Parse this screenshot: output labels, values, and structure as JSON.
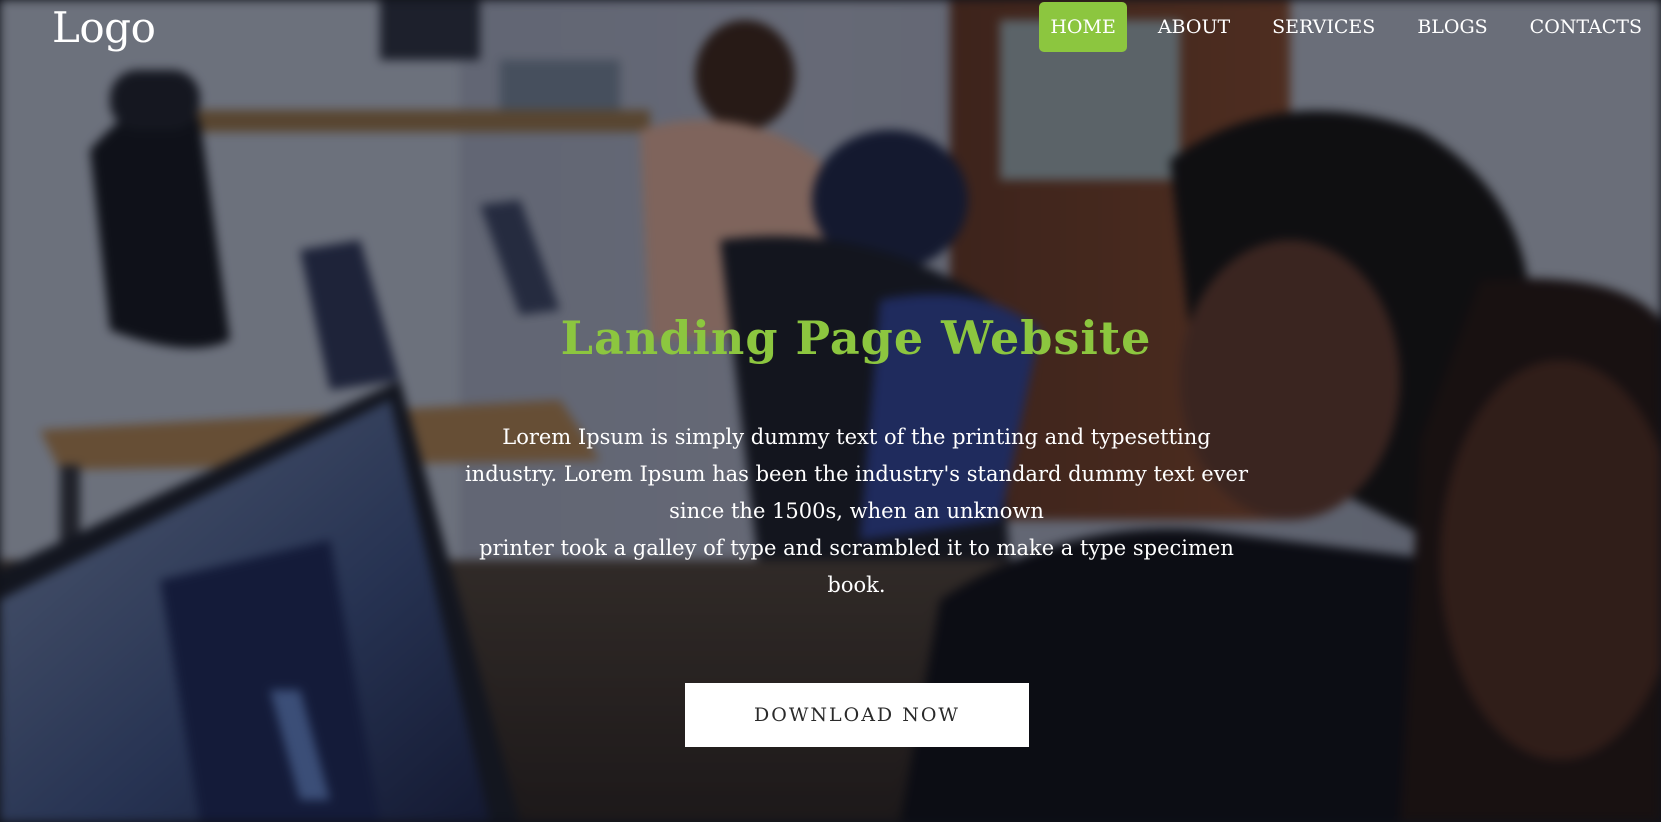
{
  "logo": {
    "text": "Logo"
  },
  "nav": {
    "items": [
      {
        "label": "HOME",
        "active": true
      },
      {
        "label": "ABOUT",
        "active": false
      },
      {
        "label": "SERVICES",
        "active": false
      },
      {
        "label": "BLOGS",
        "active": false
      },
      {
        "label": "CONTACTS",
        "active": false
      }
    ]
  },
  "hero": {
    "title": "Landing Page Website",
    "description_lines": [
      "Lorem Ipsum is simply dummy text of the printing and typesetting industry. Lorem Ipsum has been the industry's standard dummy text ever since the 1500s, when an unknown",
      "printer took a galley of type and scrambled it to make a type specimen book."
    ],
    "cta_label": "DOWNLOAD NOW"
  },
  "colors": {
    "accent": "#8cc63f",
    "text": "#ffffff",
    "button_bg": "#ffffff",
    "button_text": "#2a2a2a"
  }
}
